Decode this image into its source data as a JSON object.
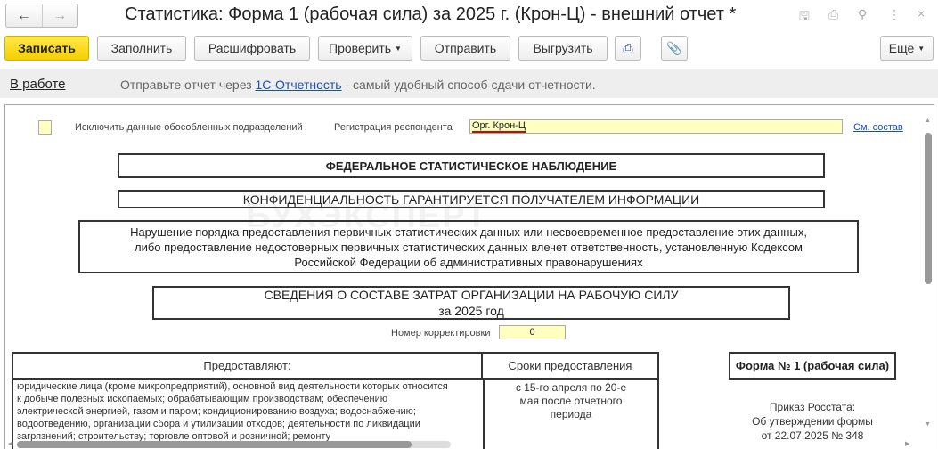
{
  "window": {
    "title": "Статистика: Форма 1 (рабочая сила) за 2025 г. (Крон-Ц) - внешний отчет *",
    "close": "×"
  },
  "toolbar": {
    "save": "Записать",
    "fill": "Заполнить",
    "decode": "Расшифровать",
    "check": "Проверить",
    "send": "Отправить",
    "export": "Выгрузить",
    "more": "Еще"
  },
  "infobar": {
    "status": "В работе",
    "text_before": "Отправьте отчет через ",
    "link": "1С-Отчетность",
    "text_after": " - самый удобный способ сдачи отчетности."
  },
  "form": {
    "exclude_label": "Исключить данные обособленных подразделений",
    "registration_label": "Регистрация респондента",
    "registration_value": "Орг. Крон-Ц",
    "composition_link": "См. состав",
    "federal": "ФЕДЕРАЛЬНОЕ СТАТИСТИЧЕСКОЕ НАБЛЮДЕНИЕ",
    "confidential": "КОНФИДЕНЦИАЛЬНОСТЬ ГАРАНТИРУЕТСЯ ПОЛУЧАТЕЛЕМ ИНФОРМАЦИИ",
    "violation": "Нарушение порядка предоставления первичных статистических данных или несвоевременное предоставление этих данных, либо предоставление недостоверных первичных статистических данных влечет ответственность, установленную Кодексом Российской Федерации об административных правонарушениях",
    "info_title_1": "СВЕДЕНИЯ О СОСТАВЕ ЗАТРАТ ОРГАНИЗАЦИИ НА РАБОЧУЮ СИЛУ",
    "info_title_2": "за 2025 год",
    "correction_label": "Номер корректировки",
    "correction_value": "0",
    "table_head_providers": "Предоставляют:",
    "table_head_deadlines": "Сроки предоставления",
    "providers_text": "юридические лица (кроме микропредприятий), основной вид деятельности которых относится к добыче полезных ископаемых; обрабатывающим производствам; обеспечению электрической энергией, газом и паром; кондиционированию воздуха; водоснабжению; водоотведению, организации сбора и утилизации отходов; деятельности по ликвидации загрязнений; строительству; торговле оптовой и розничной; ремонту",
    "deadlines_text": "с 15-го апреля по 20-е мая после отчетного периода",
    "form_name": "Форма № 1 (рабочая сила)",
    "order_1": "Приказ Росстата:",
    "order_2": "Об утверждении формы",
    "order_3": "от 22.07.2025 № 348"
  }
}
